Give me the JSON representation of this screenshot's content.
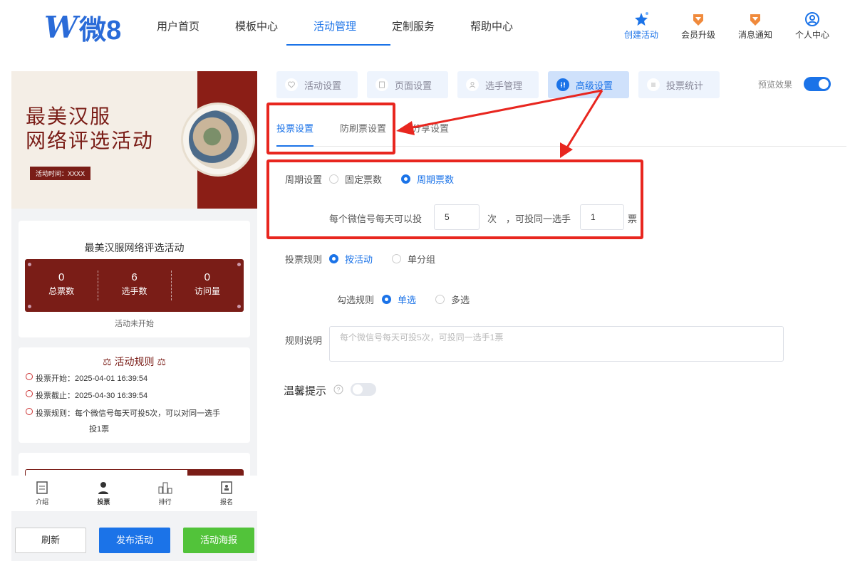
{
  "brand": {
    "logo_text": "微8"
  },
  "nav": [
    "用户首页",
    "模板中心",
    "活动管理",
    "定制服务",
    "帮助中心"
  ],
  "tools": {
    "create": "创建活动",
    "upgrade": "会员升级",
    "notify": "消息通知",
    "profile": "个人中心"
  },
  "preview_panel": {
    "banner_title_1": "最美汉服",
    "banner_title_2": "网络评选活动",
    "banner_tag": "活动时间：XXXX",
    "activity_title": "最美汉服网络评选活动",
    "stats": [
      {
        "value": "0",
        "label": "总票数"
      },
      {
        "value": "6",
        "label": "选手数"
      },
      {
        "value": "0",
        "label": "访问量"
      }
    ],
    "status": "活动未开始",
    "rules_title": "活动规则",
    "rules": [
      "投票开始：2025-04-01 16:39:54",
      "投票截止：2025-04-30 16:39:54",
      "投票规则：每个微信号每天可投5次，可以对同一选手",
      "投1票"
    ],
    "tabbar": [
      "介绍",
      "投票",
      "排行",
      "报名"
    ]
  },
  "buttons": {
    "refresh": "刷新",
    "publish": "发布活动",
    "poster": "活动海报"
  },
  "steps": [
    "活动设置",
    "页面设置",
    "选手管理",
    "高级设置",
    "投票统计"
  ],
  "preview_label": "预览效果",
  "subtabs": [
    "投票设置",
    "防刷票设置",
    "分享设置"
  ],
  "form": {
    "cycle_label": "周期设置",
    "cycle_opt_fixed": "固定票数",
    "cycle_opt_period": "周期票数",
    "per_day_label": "每个微信号每天可以投",
    "per_day_value": "5",
    "times_unit": "次",
    "same_player_label": "，可投同一选手",
    "same_player_value": "1",
    "ticket_unit": "票",
    "rule_label": "投票规则",
    "rule_opt_activity": "按活动",
    "rule_opt_group": "单分组",
    "check_label": "勾选规则",
    "check_opt_single": "单选",
    "check_opt_multi": "多选",
    "desc_label": "规则说明",
    "desc_placeholder": "每个微信号每天可投5次，可投同一选手1票",
    "tip_label": "温馨提示"
  },
  "colors": {
    "accent": "#1b73e8",
    "annotation": "#e8261f",
    "theme": "#7a1d17",
    "success": "#52c33a"
  }
}
